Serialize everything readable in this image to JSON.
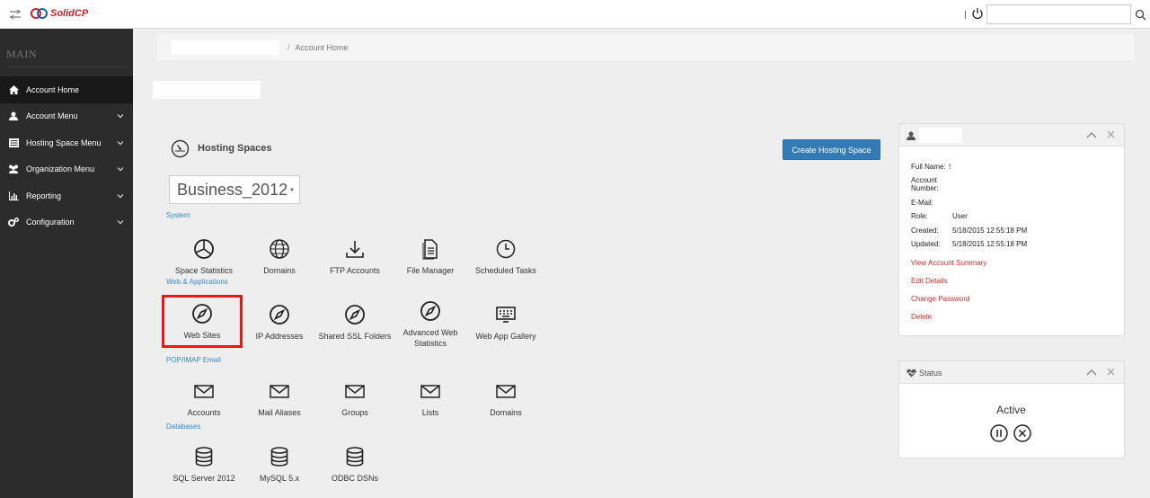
{
  "app": {
    "logo_text": "SolidCP"
  },
  "header": {
    "search_placeholder": ""
  },
  "sidebar": {
    "title": "MAIN",
    "items": [
      {
        "label": "Account Home",
        "icon": "home-icon",
        "active": true
      },
      {
        "label": "Account Menu",
        "icon": "user-icon"
      },
      {
        "label": "Hosting Space Menu",
        "icon": "server-icon"
      },
      {
        "label": "Organization Menu",
        "icon": "users-icon"
      },
      {
        "label": "Reporting",
        "icon": "bar-chart-icon"
      },
      {
        "label": "Configuration",
        "icon": "cogs-icon"
      }
    ]
  },
  "breadcrumb": {
    "separator": "/",
    "current": "Account Home"
  },
  "hosting": {
    "title": "Hosting Spaces",
    "create_button": "Create Hosting Space",
    "selected_space": "Business_2012"
  },
  "sections": [
    {
      "label": "System",
      "items": [
        {
          "label": "Space Statistics",
          "icon": "pie-chart-icon"
        },
        {
          "label": "Domains",
          "icon": "globe-icon"
        },
        {
          "label": "FTP Accounts",
          "icon": "download-icon"
        },
        {
          "label": "File Manager",
          "icon": "file-icon"
        },
        {
          "label": "Scheduled Tasks",
          "icon": "clock-icon"
        }
      ]
    },
    {
      "label": "Web & Applications",
      "items": [
        {
          "label": "Web Sites",
          "icon": "compass-icon",
          "highlighted": true
        },
        {
          "label": "IP Addresses",
          "icon": "compass-icon"
        },
        {
          "label": "Shared SSL Folders",
          "icon": "compass-icon"
        },
        {
          "label": "Advanced Web Statistics",
          "icon": "compass-icon"
        },
        {
          "label": "Web App Gallery",
          "icon": "keyboard-icon"
        }
      ]
    },
    {
      "label": "POP/IMAP Email",
      "items": [
        {
          "label": "Accounts",
          "icon": "envelope-icon"
        },
        {
          "label": "Mail Aliases",
          "icon": "envelope-icon"
        },
        {
          "label": "Groups",
          "icon": "envelope-icon"
        },
        {
          "label": "Lists",
          "icon": "envelope-icon"
        },
        {
          "label": "Domains",
          "icon": "envelope-icon"
        }
      ]
    },
    {
      "label": "Databases",
      "items": [
        {
          "label": "SQL Server 2012",
          "icon": "database-icon"
        },
        {
          "label": "MySQL 5.x",
          "icon": "database-icon"
        },
        {
          "label": "ODBC DSNs",
          "icon": "database-icon"
        }
      ]
    }
  ],
  "account_card": {
    "fields": [
      {
        "label": "Full Name:",
        "value": "!"
      },
      {
        "label": "Account Number:",
        "value": ""
      },
      {
        "label": "E-Mail:",
        "value": ""
      },
      {
        "label": "Role:",
        "value": "User"
      },
      {
        "label": "Created:",
        "value": "5/18/2015 12:55:18 PM"
      },
      {
        "label": "Updated:",
        "value": "5/18/2015 12:55:18 PM"
      }
    ],
    "links": [
      "View Account Summary",
      "Edit Details",
      "Change Password",
      "Delete"
    ]
  },
  "status_card": {
    "title": "Status",
    "value": "Active"
  },
  "colors": {
    "accent": "#337ab7",
    "highlight": "#e21a1a",
    "link": "#c9302c",
    "sidebar": "#2c2c2c"
  }
}
